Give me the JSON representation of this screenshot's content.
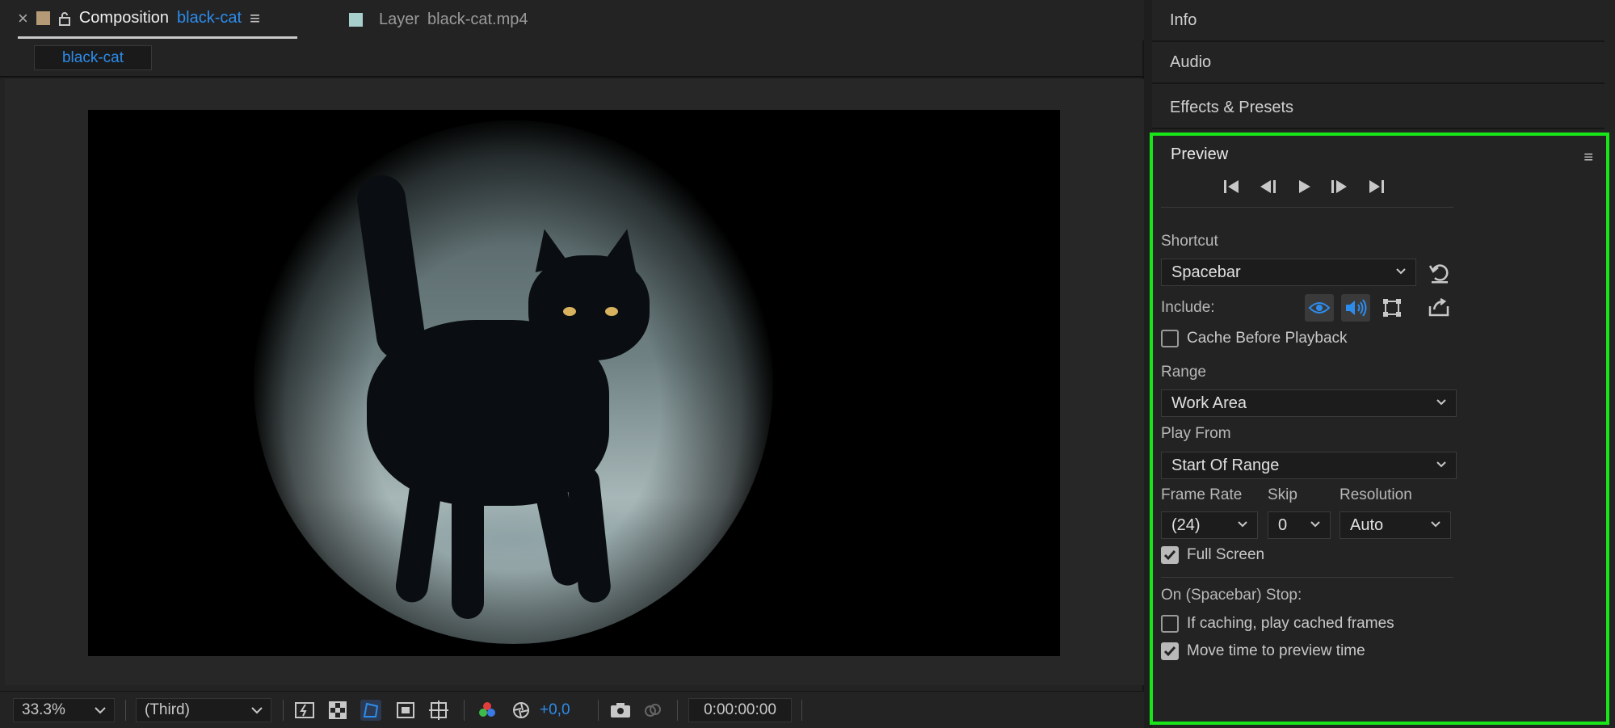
{
  "comp_tab": {
    "close": "×",
    "label": "Composition",
    "name": "black-cat",
    "menu": "≡"
  },
  "layer_tab": {
    "label": "Layer",
    "name": "black-cat.mp4"
  },
  "subtab": "black-cat",
  "bottom_bar": {
    "zoom": "33.3%",
    "resolution": "(Third)",
    "exposure": "+0,0",
    "timecode": "0:00:00:00"
  },
  "panels": {
    "info": "Info",
    "audio": "Audio",
    "effects": "Effects & Presets"
  },
  "preview": {
    "title": "Preview",
    "shortcut_label": "Shortcut",
    "shortcut_value": "Spacebar",
    "include_label": "Include:",
    "cache_label": "Cache Before Playback",
    "range_label": "Range",
    "range_value": "Work Area",
    "play_from_label": "Play From",
    "play_from_value": "Start Of Range",
    "frame_rate_label": "Frame Rate",
    "frame_rate_value": "(24)",
    "skip_label": "Skip",
    "skip_value": "0",
    "resolution_label": "Resolution",
    "resolution_value": "Auto",
    "full_screen_label": "Full Screen",
    "stop_label": "On (Spacebar) Stop:",
    "if_caching_label": "If caching, play cached frames",
    "move_time_label": "Move time to preview time",
    "checkboxes": {
      "cache": false,
      "full_screen": true,
      "if_caching": false,
      "move_time": true
    }
  },
  "colors": {
    "accent_blue": "#2d8ceb",
    "highlight_green": "#19e619",
    "comp_swatch": "#b59a78",
    "layer_swatch": "#a9cfcd"
  }
}
